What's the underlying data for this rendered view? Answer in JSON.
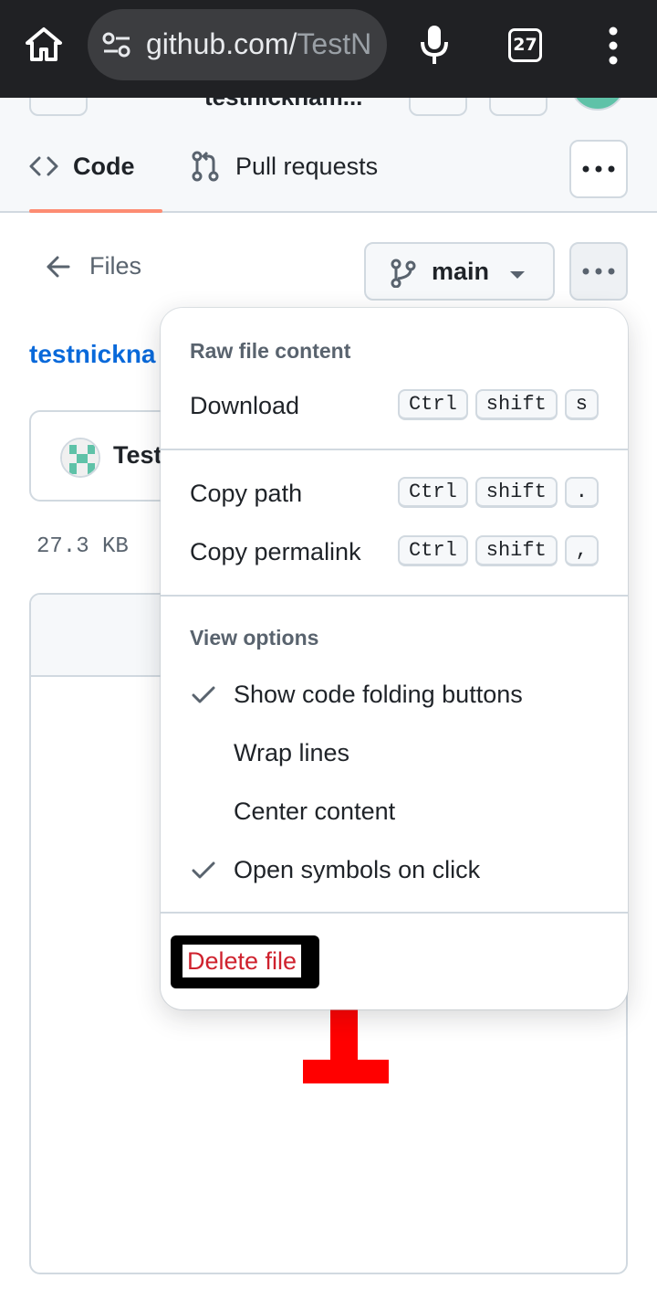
{
  "browser": {
    "url_host": "github.com/",
    "url_rest": "TestN",
    "tab_count": "27"
  },
  "header": {
    "owner": "testnickham..."
  },
  "repo_nav": {
    "code_label": "Code",
    "pull_requests_label": "Pull requests"
  },
  "file_header": {
    "files_label": "Files",
    "branch": "main"
  },
  "repo_name": "testnickna",
  "commit": {
    "author": "Test"
  },
  "file_size": "27.3 KB",
  "menu": {
    "raw_header": "Raw file content",
    "download": {
      "label": "Download",
      "keys": [
        "Ctrl",
        "shift",
        "s"
      ]
    },
    "copy_path": {
      "label": "Copy path",
      "keys": [
        "Ctrl",
        "shift",
        "."
      ]
    },
    "copy_permalink": {
      "label": "Copy permalink",
      "keys": [
        "Ctrl",
        "shift",
        ","
      ]
    },
    "view_header": "View options",
    "view_options": [
      {
        "label": "Show code folding buttons",
        "checked": true
      },
      {
        "label": "Wrap lines",
        "checked": false
      },
      {
        "label": "Center content",
        "checked": false
      },
      {
        "label": "Open symbols on click",
        "checked": true
      }
    ],
    "delete": "Delete file"
  },
  "colors": {
    "accent_link": "#0969da",
    "danger": "#cf222e",
    "tab_underline": "#fd8c73",
    "annotation_red": "#ff0000"
  }
}
